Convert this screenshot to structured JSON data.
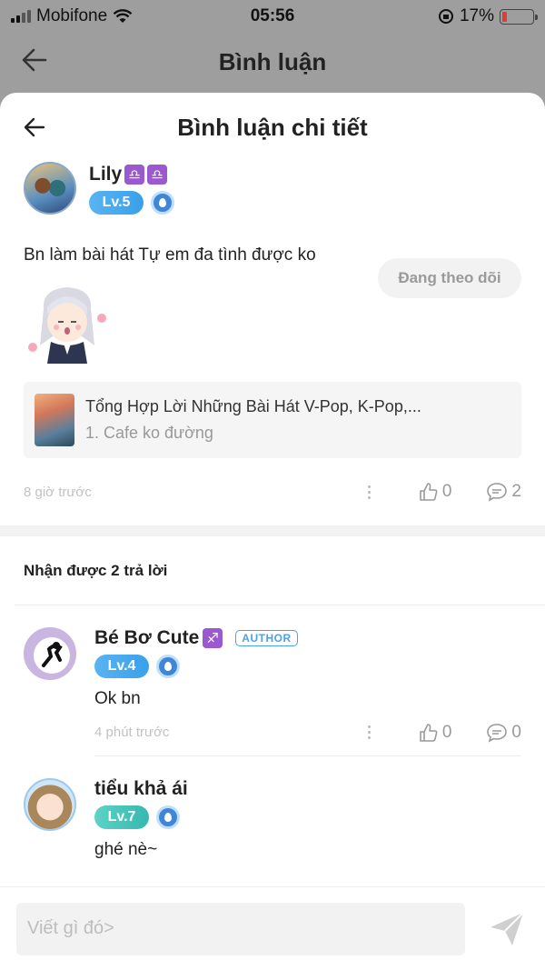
{
  "status_bar": {
    "carrier": "Mobifone",
    "time": "05:56",
    "battery": "17%",
    "battery_level": 0.17
  },
  "background_header": {
    "title": "Bình luận"
  },
  "sheet": {
    "title": "Bình luận chi tiết",
    "comment": {
      "author": "Lily",
      "zodiac": [
        "♎",
        "♎"
      ],
      "level": "Lv.5",
      "follow_label": "Đang theo dõi",
      "text": "Bn làm bài hát Tự em đa tình được ko",
      "card": {
        "title": "Tổng Hợp Lời Những Bài Hát V-Pop, K-Pop,...",
        "subtitle": "1. Cafe ko đường"
      },
      "time": "8 giờ trước",
      "likes": "0",
      "replies": "2"
    },
    "replies_header": "Nhận được 2 trả lời",
    "replies": [
      {
        "author": "Bé Bơ Cute",
        "zodiac": "♐",
        "badge": "AUTHOR",
        "level": "Lv.4",
        "text": "Ok bn",
        "time": "4 phút trước",
        "likes": "0",
        "comments": "0"
      },
      {
        "author": "tiểu khả ái",
        "level": "Lv.7",
        "text": "ghé nè~"
      }
    ],
    "input_placeholder": "Viết gì đó>"
  }
}
